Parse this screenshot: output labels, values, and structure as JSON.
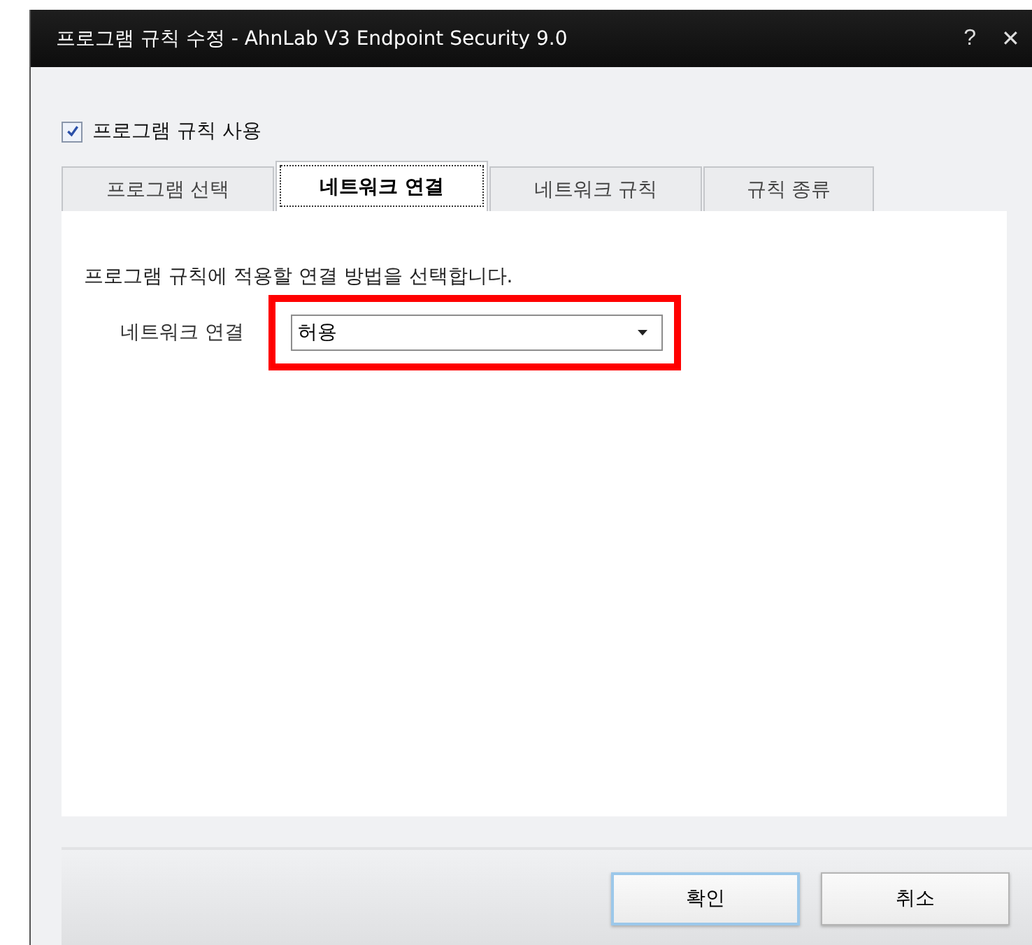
{
  "window": {
    "title": "프로그램 규칙 수정 - AhnLab V3 Endpoint Security 9.0",
    "help": "?",
    "close": "✕"
  },
  "enable_rule": {
    "label": "프로그램 규칙 사용",
    "checked": true
  },
  "tabs": [
    {
      "label": "프로그램 선택",
      "selected": false
    },
    {
      "label": "네트워크 연결",
      "selected": true
    },
    {
      "label": "네트워크 규칙",
      "selected": false
    },
    {
      "label": "규칙 종류",
      "selected": false
    }
  ],
  "description": "프로그램 규칙에 적용할 연결 방법을 선택합니다.",
  "network_connection": {
    "label": "네트워크 연결",
    "value": "허용",
    "highlighted": true
  },
  "buttons": [
    {
      "label": "확인",
      "selected": true
    },
    {
      "label": "취소",
      "selected": false
    }
  ]
}
